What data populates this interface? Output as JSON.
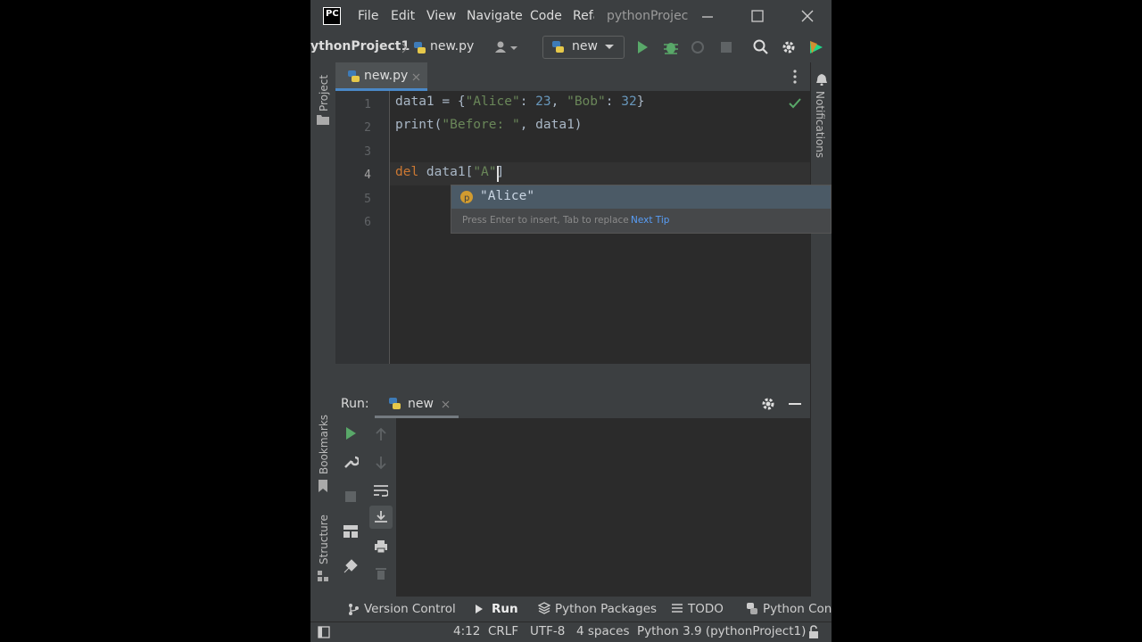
{
  "window": {
    "logo_text": "PC",
    "menu": [
      "File",
      "Edit",
      "View",
      "Navigate",
      "Code",
      "Refa"
    ],
    "title": "pythonProjec"
  },
  "navbar": {
    "project": "ythonProject1",
    "file": "new.py",
    "run_config": "new"
  },
  "editor": {
    "tab_label": "new.py",
    "line_numbers": [
      "1",
      "2",
      "3",
      "4",
      "5",
      "6"
    ],
    "code": {
      "l1_a": "data1 = {",
      "l1_k1": "\"Alice\"",
      "l1_c1": ": ",
      "l1_v1": "23",
      "l1_c2": ", ",
      "l1_k2": "\"Bob\"",
      "l1_c3": ": ",
      "l1_v2": "32",
      "l1_z": "}",
      "l2_fn": "print(",
      "l2_str": "\"Before: \"",
      "l2_rest": ", data1)",
      "l4_kw": "del",
      "l4_mid": " data1[",
      "l4_str": "\"A\"",
      "l4_end": "]"
    },
    "completion": {
      "item": "\"Alice\"",
      "hint": "Press Enter to insert, Tab to replace",
      "next_tip": "Next Tip"
    }
  },
  "side_labels": {
    "project": "Project",
    "notifications": "Notifications",
    "bookmarks": "Bookmarks",
    "structure": "Structure"
  },
  "run_panel": {
    "title": "Run:",
    "tab": "new"
  },
  "bottom_tabs": [
    "Version Control",
    "Run",
    "Python Packages",
    "TODO",
    "Python Cons"
  ],
  "status": {
    "position": "4:12",
    "line_sep": "CRLF",
    "encoding": "UTF-8",
    "indent": "4 spaces",
    "interpreter": "Python 3.9 (pythonProject1)"
  },
  "colors": {
    "keyword": "#cc7832",
    "string": "#6a8759",
    "number": "#6897bb",
    "run_green": "#59a869",
    "link_blue": "#589df6"
  }
}
